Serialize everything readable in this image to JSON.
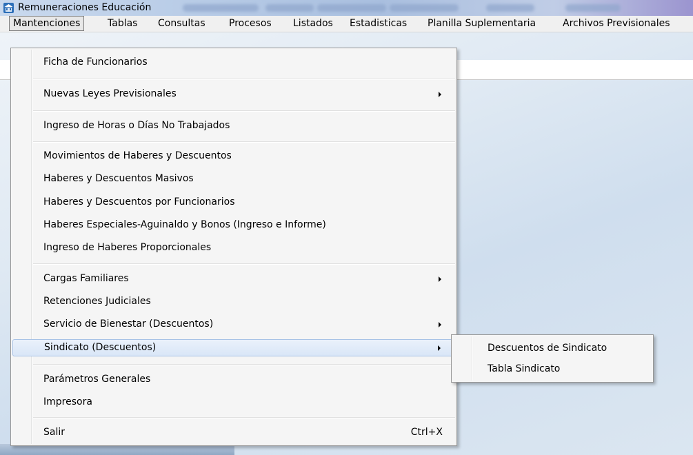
{
  "window": {
    "title": "Remuneraciones Educación",
    "icon": "school-building-icon"
  },
  "menubar": {
    "items": [
      {
        "label": "Mantenciones",
        "open": true
      },
      {
        "label": "Tablas"
      },
      {
        "label": "Consultas"
      },
      {
        "label": "Procesos"
      },
      {
        "label": "Listados"
      },
      {
        "label": "Estadisticas"
      },
      {
        "label": "Planilla Suplementaria"
      },
      {
        "label": "Archivos Previsionales"
      }
    ]
  },
  "dropdown": {
    "items": [
      {
        "label": "Ficha de Funcionarios"
      },
      {
        "label": "Nuevas Leyes Previsionales",
        "submenu": true
      },
      {
        "label": "Ingreso de Horas o Días No Trabajados"
      },
      {
        "label": "Movimientos de Haberes y Descuentos"
      },
      {
        "label": "Haberes y Descuentos Masivos"
      },
      {
        "label": "Haberes y Descuentos por Funcionarios"
      },
      {
        "label": "Haberes Especiales-Aguinaldo y Bonos (Ingreso e Informe)"
      },
      {
        "label": "Ingreso de Haberes Proporcionales"
      },
      {
        "label": "Cargas Familiares",
        "submenu": true
      },
      {
        "label": "Retenciones Judiciales"
      },
      {
        "label": "Servicio de Bienestar (Descuentos)",
        "submenu": true
      },
      {
        "label": "Sindicato (Descuentos)",
        "submenu": true,
        "highlighted": true
      },
      {
        "label": "Parámetros Generales"
      },
      {
        "label": "Impresora"
      },
      {
        "label": "Salir",
        "shortcut": "Ctrl+X"
      }
    ]
  },
  "submenu": {
    "items": [
      {
        "label": "Descuentos de Sindicato"
      },
      {
        "label": "Tabla Sindicato"
      }
    ]
  },
  "colors": {
    "menu_bg": "#f5f5f5",
    "highlight_bg": "#d9e6f7",
    "highlight_border": "#a8c3e6"
  }
}
